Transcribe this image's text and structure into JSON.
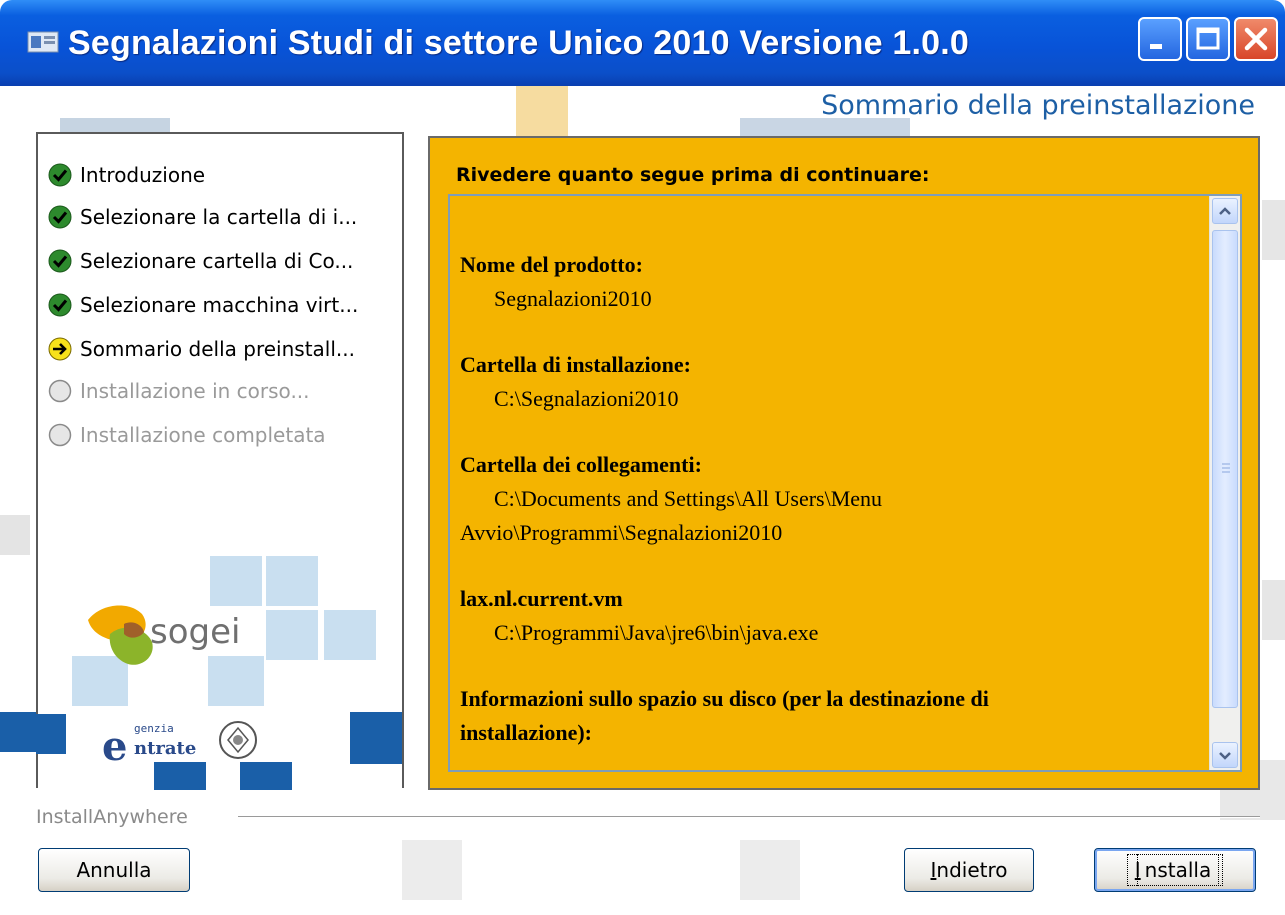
{
  "window": {
    "title": "Segnalazioni Studi di settore Unico 2010 Versione 1.0.0",
    "buttons": {
      "minimize": "minimize",
      "maximize": "maximize",
      "close": "close"
    }
  },
  "heading": "Sommario della preinstallazione",
  "steps": [
    {
      "label": "Introduzione",
      "state": "done"
    },
    {
      "label": "Selezionare la cartella di i...",
      "state": "done"
    },
    {
      "label": "Selezionare cartella di Co...",
      "state": "done"
    },
    {
      "label": "Selezionare macchina virt...",
      "state": "done"
    },
    {
      "label": "Sommario della preinstall...",
      "state": "current"
    },
    {
      "label": "Installazione in corso...",
      "state": "pending"
    },
    {
      "label": "Installazione completata",
      "state": "pending"
    }
  ],
  "logos": {
    "sogei": "sogei",
    "entrate": "genzia ntrate"
  },
  "summary": {
    "intro": "Rivedere quanto segue prima di continuare:",
    "product_label": "Nome del prodotto:",
    "product_value": "Segnalazioni2010",
    "install_folder_label": "Cartella di installazione:",
    "install_folder_value": "C:\\Segnalazioni2010",
    "links_folder_label": "Cartella dei collegamenti:",
    "links_folder_value_1": "C:\\Documents and Settings\\All Users\\Menu",
    "links_folder_value_2": "Avvio\\Programmi\\Segnalazioni2010",
    "vm_label": "lax.nl.current.vm",
    "vm_value": "C:\\Programmi\\Java\\jre6\\bin\\java.exe",
    "disk_label_1": "Informazioni sullo spazio su disco (per la destinazione di",
    "disk_label_2": "installazione):"
  },
  "footer": {
    "brand": "InstallAnywhere",
    "cancel": "Annulla",
    "back_mnemonic": "I",
    "back_rest": "ndietro",
    "install_mnemonic": "I",
    "install_rest": "nstalla"
  },
  "colors": {
    "titlebar": "#0853d8",
    "panel": "#f4b400",
    "heading": "#1d5fa5"
  }
}
